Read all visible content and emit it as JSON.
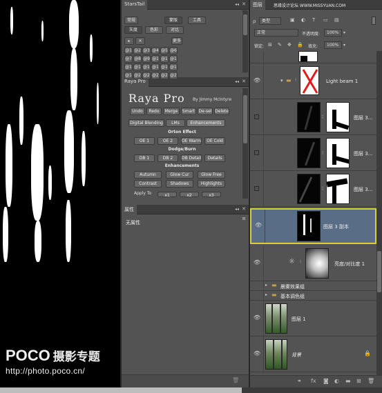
{
  "watermark": {
    "logo": "POCO",
    "cn": "摄影专题",
    "url": "http://photo.poco.cn/",
    "top_right": "思缘设计论坛 WWW.MISSYUAN.COM"
  },
  "stars_tail": {
    "tab": "StarsTail",
    "buttons_row1": [
      "常规",
      "蒙版",
      "工具"
    ],
    "buttons_row2": [
      "灰度",
      "色彩",
      "对比"
    ],
    "buttons_row3": [
      "▸",
      "✕"
    ],
    "more_label": "更多",
    "grid": [
      "@1",
      "@2",
      "@3",
      "@4",
      "@5",
      "@6",
      "@7",
      "@8",
      "@9",
      "@10",
      "@11",
      "@12",
      "@13",
      "@14",
      "@15",
      "@16",
      "@17",
      "@18",
      "@19",
      "@20",
      "@21",
      "@22",
      "@23",
      "@24"
    ]
  },
  "raya_pro": {
    "tab": "Raya Pro",
    "logo": "Raya Pro",
    "byline": "By Jimmy McIntyre",
    "row1": [
      "Undo",
      "Redo",
      "Merge",
      "Smart",
      "De-sel",
      "Delete"
    ],
    "tabs": [
      "Digital Blending",
      "LMs",
      "Enhancements"
    ],
    "orton_heading": "Orton Effect",
    "orton_buttons": [
      "OE 1",
      "OE 2",
      "OE Warm",
      "OE Cold"
    ],
    "dodge_heading": "Dodge/Burn",
    "dodge_buttons": [
      "DB 1",
      "DB 2",
      "DB Details",
      "Details"
    ],
    "enh_heading": "Enhancements",
    "enh_row1": [
      "Autumn",
      "Glow Cur",
      "Glow Free"
    ],
    "enh_row2": [
      "Contrast",
      "Shadows",
      "Highlights"
    ],
    "apply_to": "Apply To",
    "apply_buttons": [
      "x1",
      "x2",
      "x3"
    ]
  },
  "properties": {
    "tab": "属性",
    "empty_text": "无属性"
  },
  "layers_panel": {
    "tab": "图层",
    "filter_type": "类型",
    "blend_mode": "正常",
    "opacity_label": "不透明度:",
    "opacity_value": "100%",
    "lock_label": "锁定:",
    "fill_label": "填充:",
    "fill_value": "100%",
    "layers": [
      {
        "name": "Light beam 1"
      },
      {
        "name": "图层 3..."
      },
      {
        "name": "图层 3..."
      },
      {
        "name": "图层 3..."
      },
      {
        "name": "图层 3 副本"
      },
      {
        "name": "亮度/对比度 1"
      },
      {
        "name": "晨雾效果组"
      },
      {
        "name": "基本调色组"
      },
      {
        "name": "图层 1"
      },
      {
        "name": "背景"
      }
    ],
    "footer_icons": [
      "link-icon",
      "fx",
      "mask-icon",
      "adjustment-icon",
      "folder-icon",
      "new-layer-icon",
      "trash-icon"
    ]
  },
  "colors": {
    "selection_outline": "#d7d030",
    "selected_row": "#5a6d86",
    "panel_bg": "#535353"
  }
}
